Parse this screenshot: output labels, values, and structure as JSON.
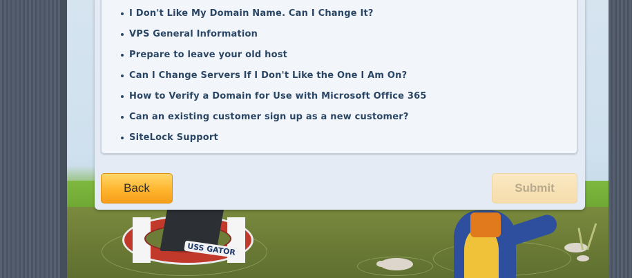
{
  "articles": [
    "I Don't Like My Domain Name. Can I Change It?",
    "VPS General Information",
    "Prepare to leave your old host",
    "Can I Change Servers If I Don't Like the One I Am On?",
    "How to Verify a Domain for Use with Microsoft Office 365",
    "Can an existing customer sign up as a new customer?",
    "SiteLock Support"
  ],
  "buttons": {
    "back": "Back",
    "submit": "Submit"
  },
  "illustration": {
    "ring_label": "USS GATOR"
  },
  "colors": {
    "accent_orange": "#ffb52e",
    "link_text": "#2a4664",
    "panel_bg": "#e4ebf4"
  }
}
